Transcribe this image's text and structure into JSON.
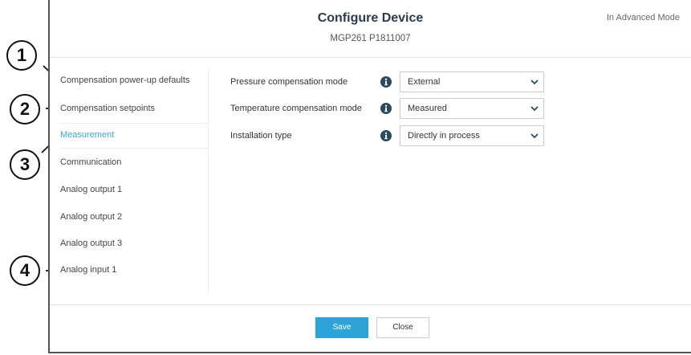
{
  "header": {
    "title": "Configure Device",
    "subtitle": "MGP261 P1811007",
    "mode": "In Advanced Mode"
  },
  "sidebar": {
    "items": [
      {
        "label": "Compensation power-up defaults",
        "active": false
      },
      {
        "label": "Compensation setpoints",
        "active": false
      },
      {
        "label": "Measurement",
        "active": true
      },
      {
        "label": "Communication",
        "active": false
      },
      {
        "label": "Analog output 1",
        "active": false
      },
      {
        "label": "Analog output 2",
        "active": false
      },
      {
        "label": "Analog output 3",
        "active": false
      },
      {
        "label": "Analog input 1",
        "active": false
      }
    ]
  },
  "settings": [
    {
      "label": "Pressure compensation mode",
      "value": "External",
      "icon": "info-icon"
    },
    {
      "label": "Temperature compensation mode",
      "value": "Measured",
      "icon": "info-icon"
    },
    {
      "label": "Installation type",
      "value": "Directly in process",
      "icon": "info-icon"
    }
  ],
  "footer": {
    "save_label": "Save",
    "close_label": "Close"
  },
  "callouts": [
    "1",
    "2",
    "3",
    "4"
  ],
  "colors": {
    "accent": "#2ea3d8",
    "active_nav": "#3da4cf",
    "title": "#2a3c4c",
    "info_icon": "#2b4a5e"
  }
}
